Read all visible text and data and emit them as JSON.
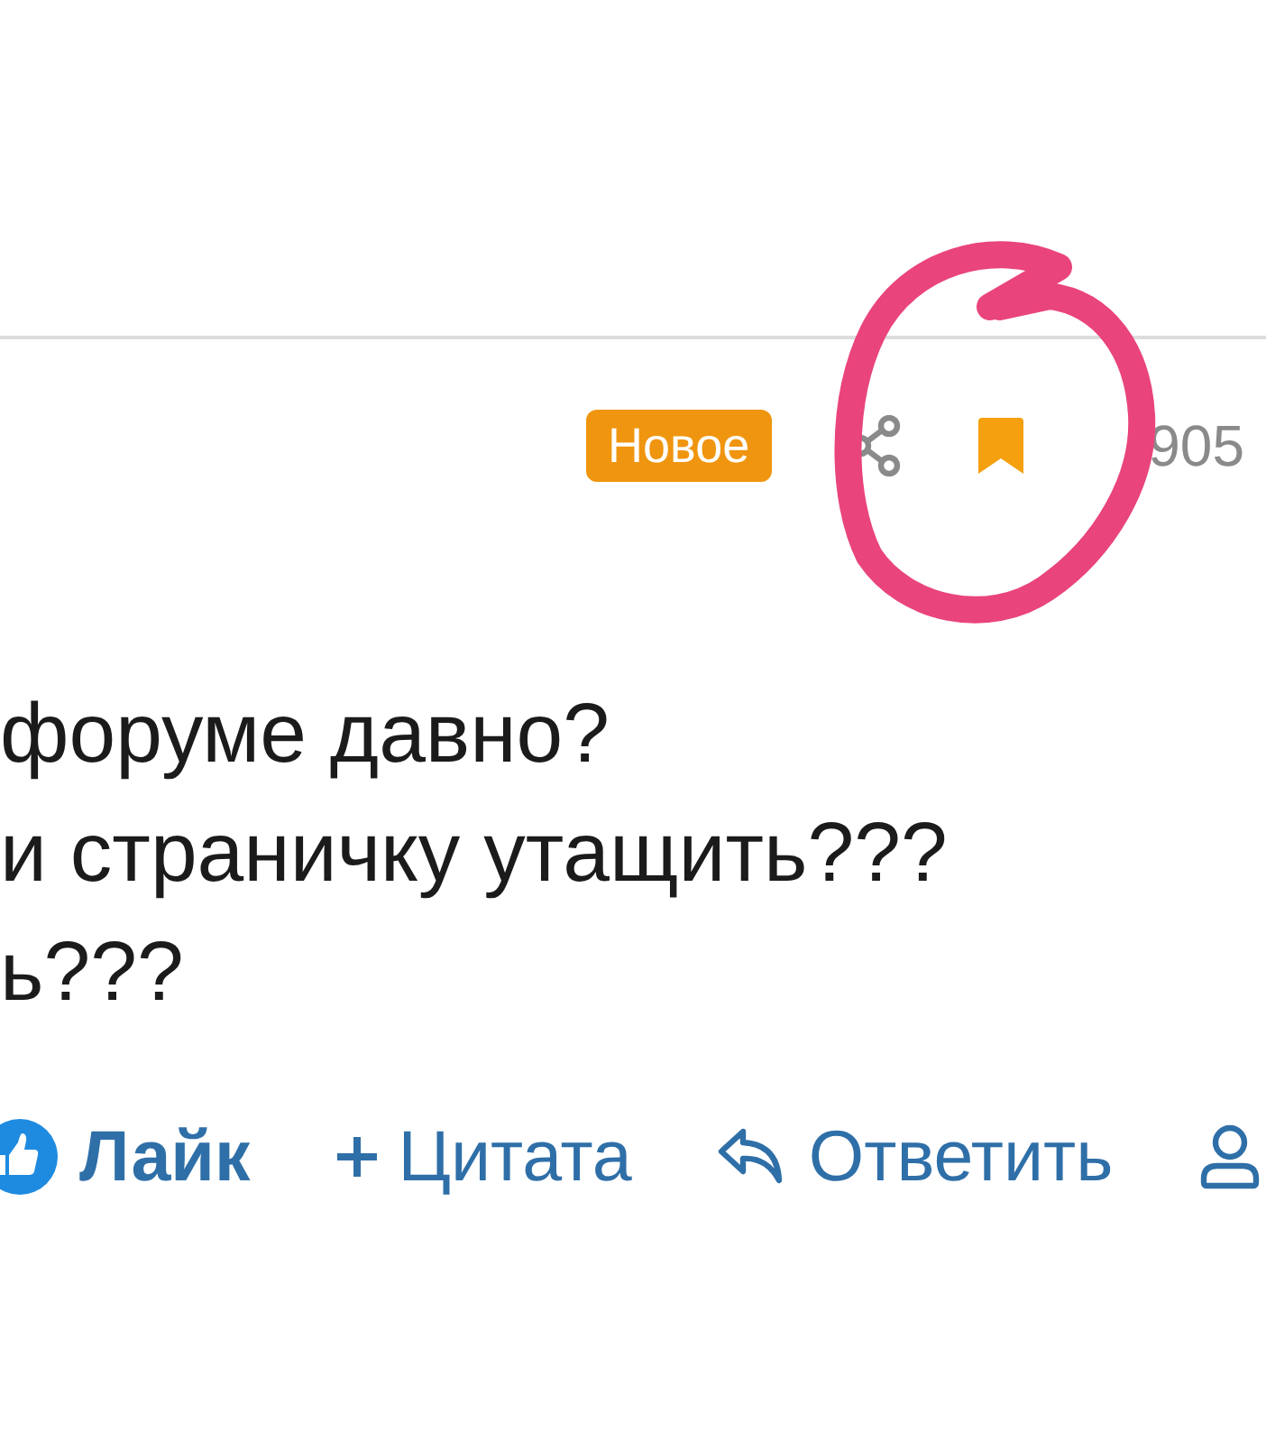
{
  "post_header": {
    "badge": "Новое",
    "bookmarked": true,
    "post_number": "905"
  },
  "post_body": {
    "lines": [
      "форуме давно?",
      "и страничку утащить???",
      "ь???"
    ]
  },
  "actions": [
    {
      "kind": "like",
      "label": "Лайк"
    },
    {
      "kind": "quote",
      "label": "Цитата"
    },
    {
      "kind": "reply",
      "label": "Ответить"
    },
    {
      "kind": "profile"
    }
  ]
}
